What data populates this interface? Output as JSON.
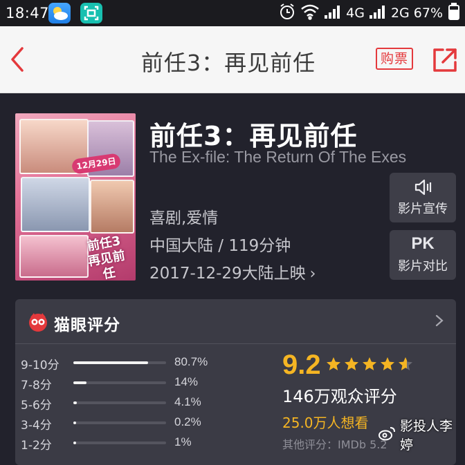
{
  "status_bar": {
    "time": "18:47",
    "network_1": "4G",
    "network_2": "2G",
    "battery": "67%"
  },
  "nav": {
    "title": "前任3：再见前任",
    "buy_label": "购票",
    "accent_color": "#e4393c"
  },
  "movie": {
    "title_cn": "前任3：再见前任",
    "title_en": "The Ex-file: The Return Of The Exes",
    "genre": "喜剧,爱情",
    "region_duration": "中国大陆 / 119分钟",
    "release": "2017-12-29大陆上映",
    "poster": {
      "date_stamp": "12月29日",
      "logo_text": "前任3 再见前任"
    }
  },
  "side_buttons": {
    "promo_label": "影片宣传",
    "pk_icon_text": "PK",
    "pk_label": "影片对比"
  },
  "rating": {
    "header": "猫眼评分",
    "distribution": [
      {
        "label": "9-10分",
        "pct": "80.7%",
        "value": 80.7
      },
      {
        "label": "7-8分",
        "pct": "14%",
        "value": 14
      },
      {
        "label": "5-6分",
        "pct": "4.1%",
        "value": 4.1
      },
      {
        "label": "3-4分",
        "pct": "0.2%",
        "value": 0.2
      },
      {
        "label": "1-2分",
        "pct": "1%",
        "value": 1
      }
    ],
    "score": "9.2",
    "stars": 4.6,
    "count_text": "146万观众评分",
    "want_text": "25.0万人想看",
    "other_text": "其他评分：IMDb 5.2",
    "score_color": "#f5b523"
  },
  "watermark": {
    "text": "影投人李婷"
  }
}
